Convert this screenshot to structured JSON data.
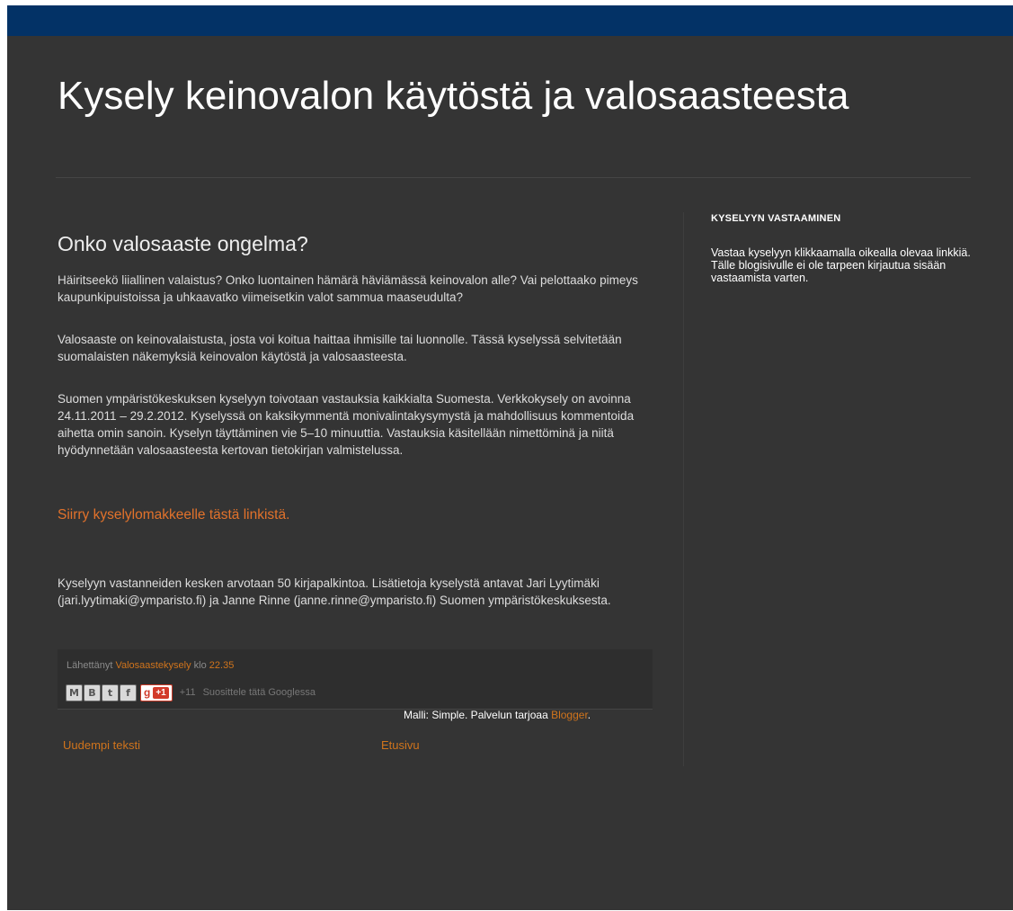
{
  "header": {
    "title": "Kysely keinovalon käytöstä ja valosaasteesta"
  },
  "post": {
    "title": "Onko valosaaste ongelma?",
    "paragraphs": [
      "Häiritseekö liiallinen valaistus? Onko luontainen hämärä häviämässä keinovalon alle? Vai pelottaako pimeys kaupunkipuistoissa ja uhkaavatko viimeisetkin valot sammua maaseudulta?",
      "Valosaaste on keinovalaistusta, josta voi koitua haittaa ihmisille tai luonnolle. Tässä kyselyssä selvitetään suomalaisten näkemyksiä keinovalon käytöstä ja valosaasteesta.",
      "Suomen ympäristökeskuksen kyselyyn toivotaan vastauksia kaikkialta Suomesta. Verkkokysely on avoinna 24.11.2011 – 29.2.2012. Kyselyssä on kaksikymmentä monivalintakysymystä ja mahdollisuus kommentoida aihetta omin sanoin. Kyselyn täyttäminen vie 5–10 minuuttia. Vastauksia käsitellään nimettöminä ja niitä hyödynnetään valosaasteesta kertovan tietokirjan valmistelussa.",
      "Kyselyyn vastanneiden kesken arvotaan 50 kirjapalkintoa. Lisätietoja kyselystä antavat Jari Lyytimäki (jari.lyytimaki@ymparisto.fi) ja Janne Rinne (janne.rinne@ymparisto.fi) Suomen ympäristökeskuksesta."
    ],
    "survey_link": "Siirry kyselylomakkeelle tästä linkistä.",
    "footer": {
      "posted_by_prefix": "Lähettänyt",
      "author": "Valosaastekysely",
      "at_word": "klo",
      "time": "22.35",
      "share_buttons": [
        "M",
        "B",
        "t",
        "f"
      ],
      "plus_one_label": "+1",
      "plus_count": "+11",
      "recommend_text": "Suosittele tätä Googlessa"
    }
  },
  "pager": {
    "newer": "Uudempi teksti",
    "home": "Etusivu"
  },
  "sidebar": {
    "heading": "KYSELYYN VASTAAMINEN",
    "text": "Vastaa kyselyyn klikkaamalla oikealla olevaa linkkiä. Tälle blogisivulle ei ole tarpeen kirjautua sisään vastaamista varten."
  },
  "footer": {
    "prefix": "Malli: Simple. Palvelun tarjoaa ",
    "link": "Blogger",
    "suffix": "."
  },
  "colors": {
    "topbar": "#033266",
    "background": "#343434",
    "link": "#d0741c"
  }
}
